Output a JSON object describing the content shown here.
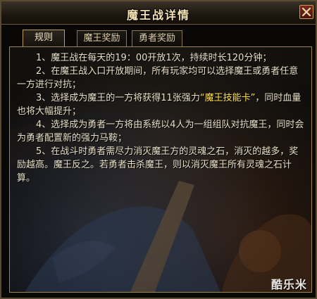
{
  "window": {
    "title": "魔王战详情"
  },
  "tabs": [
    {
      "label": "规则",
      "active": true
    },
    {
      "label": "魔王奖励",
      "active": false
    },
    {
      "label": "勇者奖励",
      "active": false
    }
  ],
  "rules": [
    {
      "text": "1、魔王战在每天的19：00开放1次，持续时长120分钟；"
    },
    {
      "text": "2、在魔王战入口开放期间，所有玩家均可以选择魔王或勇者任意一方进行对抗；"
    },
    {
      "before": "3、选择成为魔王的一方将获得11张强力",
      "highlight": "“魔王技能卡”",
      "after": "，同时血量也将大幅提升；"
    },
    {
      "text": "4、选择成为勇者一方将由系统以4人为一组组队对抗魔王，同时会为勇者配置新的强力马鞍；"
    },
    {
      "text": "5、在战斗时勇者需尽力消灭魔王方的灵魂之石，消灭的越多，奖励越高。魔王反之。若勇者击杀魔王，则以消灭魔王所有灵魂之石计算。"
    }
  ],
  "watermark": "酷乐米",
  "colors": {
    "title": "#f3e2b4",
    "text": "#e8e0c8",
    "highlight": "#ffe14a",
    "border": "#9a8458"
  }
}
